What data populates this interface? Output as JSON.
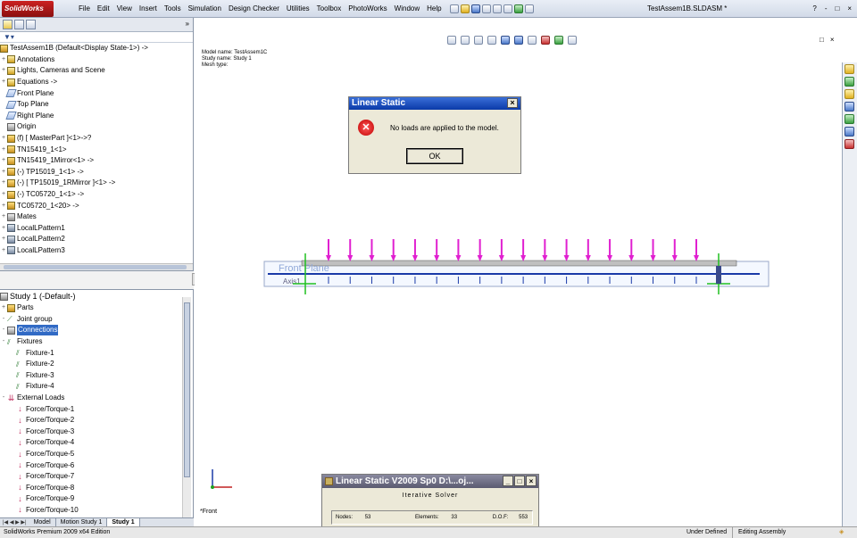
{
  "app": {
    "logo": "SolidWorks",
    "document_title": "TestAssem1B.SLDASM *"
  },
  "menu": [
    "File",
    "Edit",
    "View",
    "Insert",
    "Tools",
    "Simulation",
    "Design Checker",
    "Utilities",
    "Toolbox",
    "PhotoWorks",
    "Window",
    "Help"
  ],
  "window_controls": {
    "help": "?",
    "minimize": "-",
    "restore": "□",
    "close": "×"
  },
  "feature_tree": {
    "collapse": "»",
    "root": "TestAssem1B  (Default<Display State-1>) ->",
    "items": [
      {
        "label": "Annotations",
        "exp": "+"
      },
      {
        "label": "Lights, Cameras and Scene",
        "exp": "+"
      },
      {
        "label": "Equations ->",
        "exp": "+"
      },
      {
        "label": "Front Plane",
        "exp": ""
      },
      {
        "label": "Top Plane",
        "exp": ""
      },
      {
        "label": "Right Plane",
        "exp": ""
      },
      {
        "label": "Origin",
        "exp": ""
      },
      {
        "label": "(f) [ MasterPart ]<1>->?",
        "exp": "+"
      },
      {
        "label": "TN15419_1<1>",
        "exp": "+"
      },
      {
        "label": "TN15419_1Mirror<1> ->",
        "exp": "+"
      },
      {
        "label": "(-) TP15019_1<1> ->",
        "exp": "+"
      },
      {
        "label": "(-) [ TP15019_1RMirror ]<1> ->",
        "exp": "+"
      },
      {
        "label": "(-) TC05720_1<1> ->",
        "exp": "+"
      },
      {
        "label": "TC05720_1<20> ->",
        "exp": "+"
      },
      {
        "label": "Mates",
        "exp": "+"
      },
      {
        "label": "LocalLPattern1",
        "exp": "+"
      },
      {
        "label": "LocalLPattern2",
        "exp": "+"
      },
      {
        "label": "LocalLPattern3",
        "exp": "+"
      }
    ]
  },
  "study_tree": {
    "root": "Study 1 (-Default-)",
    "parts": "Parts",
    "joint_group": "Joint group",
    "connections": "Connections",
    "fixtures": "Fixtures",
    "fixture_items": [
      "Fixture-1",
      "Fixture-2",
      "Fixture-3",
      "Fixture-4"
    ],
    "external_loads": "External Loads",
    "load_items": [
      "Force/Torque-1",
      "Force/Torque-2",
      "Force/Torque-3",
      "Force/Torque-4",
      "Force/Torque-5",
      "Force/Torque-6",
      "Force/Torque-7",
      "Force/Torque-8",
      "Force/Torque-9",
      "Force/Torque-10"
    ]
  },
  "bottom_tabs": {
    "nav": "|◀ ◀ ▶ ▶|",
    "model": "Model",
    "motion": "Motion Study 1",
    "study": "Study 1"
  },
  "model_info": {
    "model_name": "Model name: TestAssem1C",
    "study_name": "Study name: Study 1",
    "mesh_type": "Mesh type:"
  },
  "viewport": {
    "view_name": "*Front",
    "plane_label": "Front Plane",
    "axis_label": "Axis1"
  },
  "dialog": {
    "title": "Linear Static",
    "message": "No loads are applied to the model.",
    "ok": "OK",
    "close": "×"
  },
  "progress": {
    "title": "Linear Static V2009 Sp0 D:\\...oj...",
    "solver": "Iterative Solver",
    "nodes_label": "Nodes:",
    "nodes_value": "53",
    "elements_label": "Elements:",
    "elements_value": "33",
    "dof_label": "D.O.F:",
    "dof_value": "553",
    "min": "_",
    "max": "□",
    "close": "×"
  },
  "status": {
    "product": "SolidWorks Premium 2009 x64 Edition",
    "state": "Under Defined",
    "mode": "Editing Assembly",
    "help": "◈"
  },
  "colors": {
    "load_arrow": "#e020d0",
    "fixture": "#20c020",
    "beam_line": "#1a3aa8",
    "dialog_title": "#0a3aa8"
  },
  "load_arrow_count": 18
}
